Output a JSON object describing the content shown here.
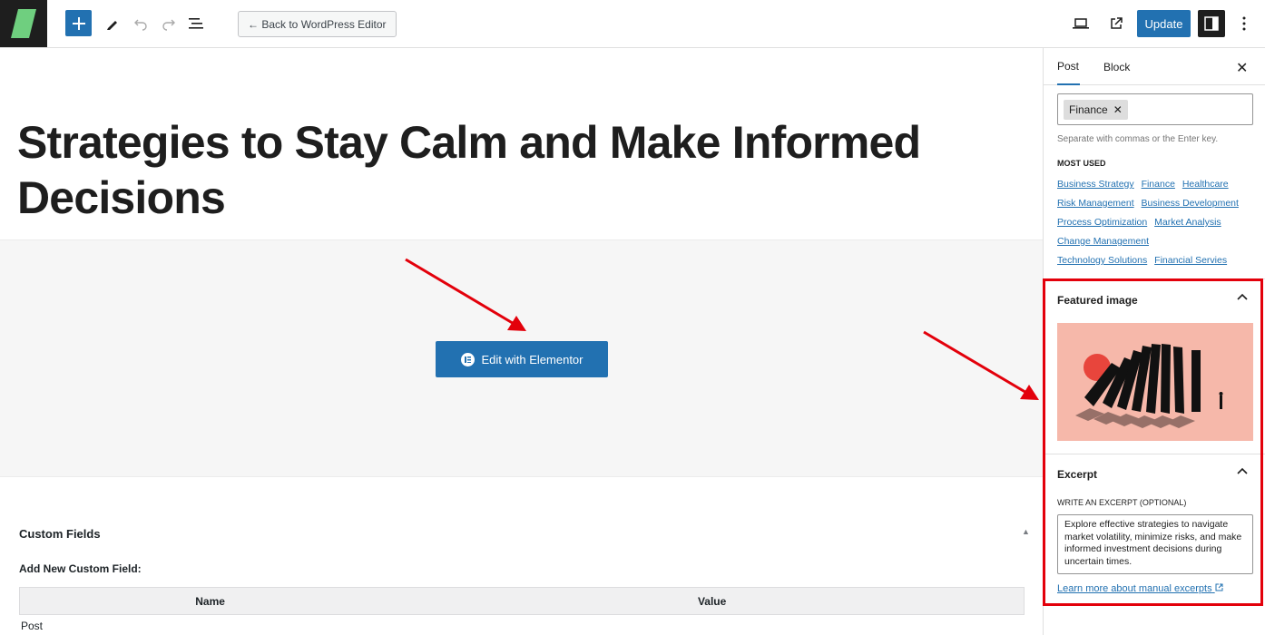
{
  "toolbar": {
    "add_icon": "plus-icon",
    "back_label": "← Back to WordPress Editor",
    "update_label": "Update",
    "icons": [
      "pencil-icon",
      "undo-icon",
      "redo-icon",
      "list-view-icon",
      "laptop-icon",
      "external-link-icon",
      "sidebar-icon",
      "more-vertical-icon"
    ],
    "accent": "#2271b1"
  },
  "post": {
    "title": "Strategies to Stay Calm and Make Informed Decisions",
    "elementor_label": "Edit with Elementor"
  },
  "custom_fields": {
    "title": "Custom Fields",
    "add_label": "Add New Custom Field:",
    "col_name": "Name",
    "col_value": "Value",
    "row_label": "Post"
  },
  "sidebar": {
    "tab_post": "Post",
    "tab_block": "Block",
    "tag_chip": "Finance",
    "tag_help": "Separate with commas or the Enter key.",
    "most_used_label": "Most used",
    "tags": [
      "Business Strategy",
      "Finance",
      "Healthcare",
      "Risk Management",
      "Business Development",
      "Process Optimization",
      "Market Analysis",
      "Change Management",
      "Technology Solutions",
      "Financial Servies"
    ],
    "featured_title": "Featured image",
    "excerpt_title": "Excerpt",
    "excerpt_label": "Write an excerpt (optional)",
    "excerpt_text": "Explore effective strategies to navigate market volatility, minimize risks, and make informed investment decisions during uncertain times.",
    "excerpt_link": "Learn more about manual excerpts"
  },
  "annotation_color": "#e3000b"
}
